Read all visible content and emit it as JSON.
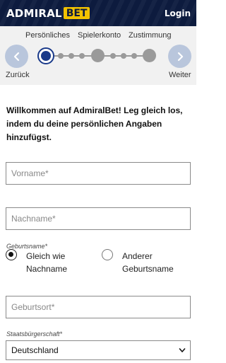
{
  "header": {
    "logo_text_1": "ADMIRAL",
    "logo_text_2": "BET",
    "login_label": "Login"
  },
  "stepper": {
    "steps": [
      "Persönliches",
      "Spielerkonto",
      "Zustimmung"
    ],
    "back_label": "Zurück",
    "next_label": "Weiter",
    "current_step": 1
  },
  "intro_text": "Willkommen auf AdmiralBet! Leg gleich los, indem du deine persönlichen Angaben hinzufügst.",
  "form": {
    "first_name_placeholder": "Vorname*",
    "last_name_placeholder": "Nachname*",
    "birth_name_label": "Geburtsname*",
    "birth_name_options": [
      "Gleich wie Nachname",
      "Anderer Geburtsname"
    ],
    "birth_name_selected": 0,
    "birth_place_placeholder": "Geburtsort*",
    "citizenship_label": "Staatsbürgerschaft*",
    "citizenship_value": "Deutschland"
  },
  "colors": {
    "header_bg": "#0d1b3e",
    "logo_accent": "#f2c200",
    "nav_button": "#b9c6dc",
    "active_step": "#1a3a8a"
  }
}
